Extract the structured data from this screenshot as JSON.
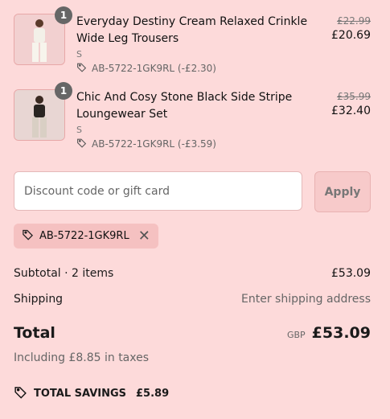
{
  "items": [
    {
      "quantity": "1",
      "name": "Everyday Destiny Cream Relaxed Crinkle Wide Leg Trousers",
      "variant": "S",
      "discount": "AB-5722-1GK9RL (-£2.30)",
      "original_price": "£22.99",
      "price": "£20.69"
    },
    {
      "quantity": "1",
      "name": "Chic And Cosy Stone Black Side Stripe Loungewear Set",
      "variant": "S",
      "discount": "AB-5722-1GK9RL (-£3.59)",
      "original_price": "£35.99",
      "price": "£32.40"
    }
  ],
  "discount_field": {
    "placeholder": "Discount code or gift card",
    "apply_label": "Apply"
  },
  "applied_code": {
    "code": "AB-5722-1GK9RL"
  },
  "summary": {
    "subtotal_label": "Subtotal · 2 items",
    "subtotal_value": "£53.09",
    "shipping_label": "Shipping",
    "shipping_value": "Enter shipping address",
    "total_label": "Total",
    "currency": "GBP",
    "total_value": "£53.09",
    "taxes_note": "Including £8.85 in taxes",
    "savings_label": "TOTAL SAVINGS",
    "savings_value": "£5.89"
  },
  "colors": {
    "background": "#fddada",
    "qty_badge": "#666666",
    "chip": "#f5c1c1"
  }
}
